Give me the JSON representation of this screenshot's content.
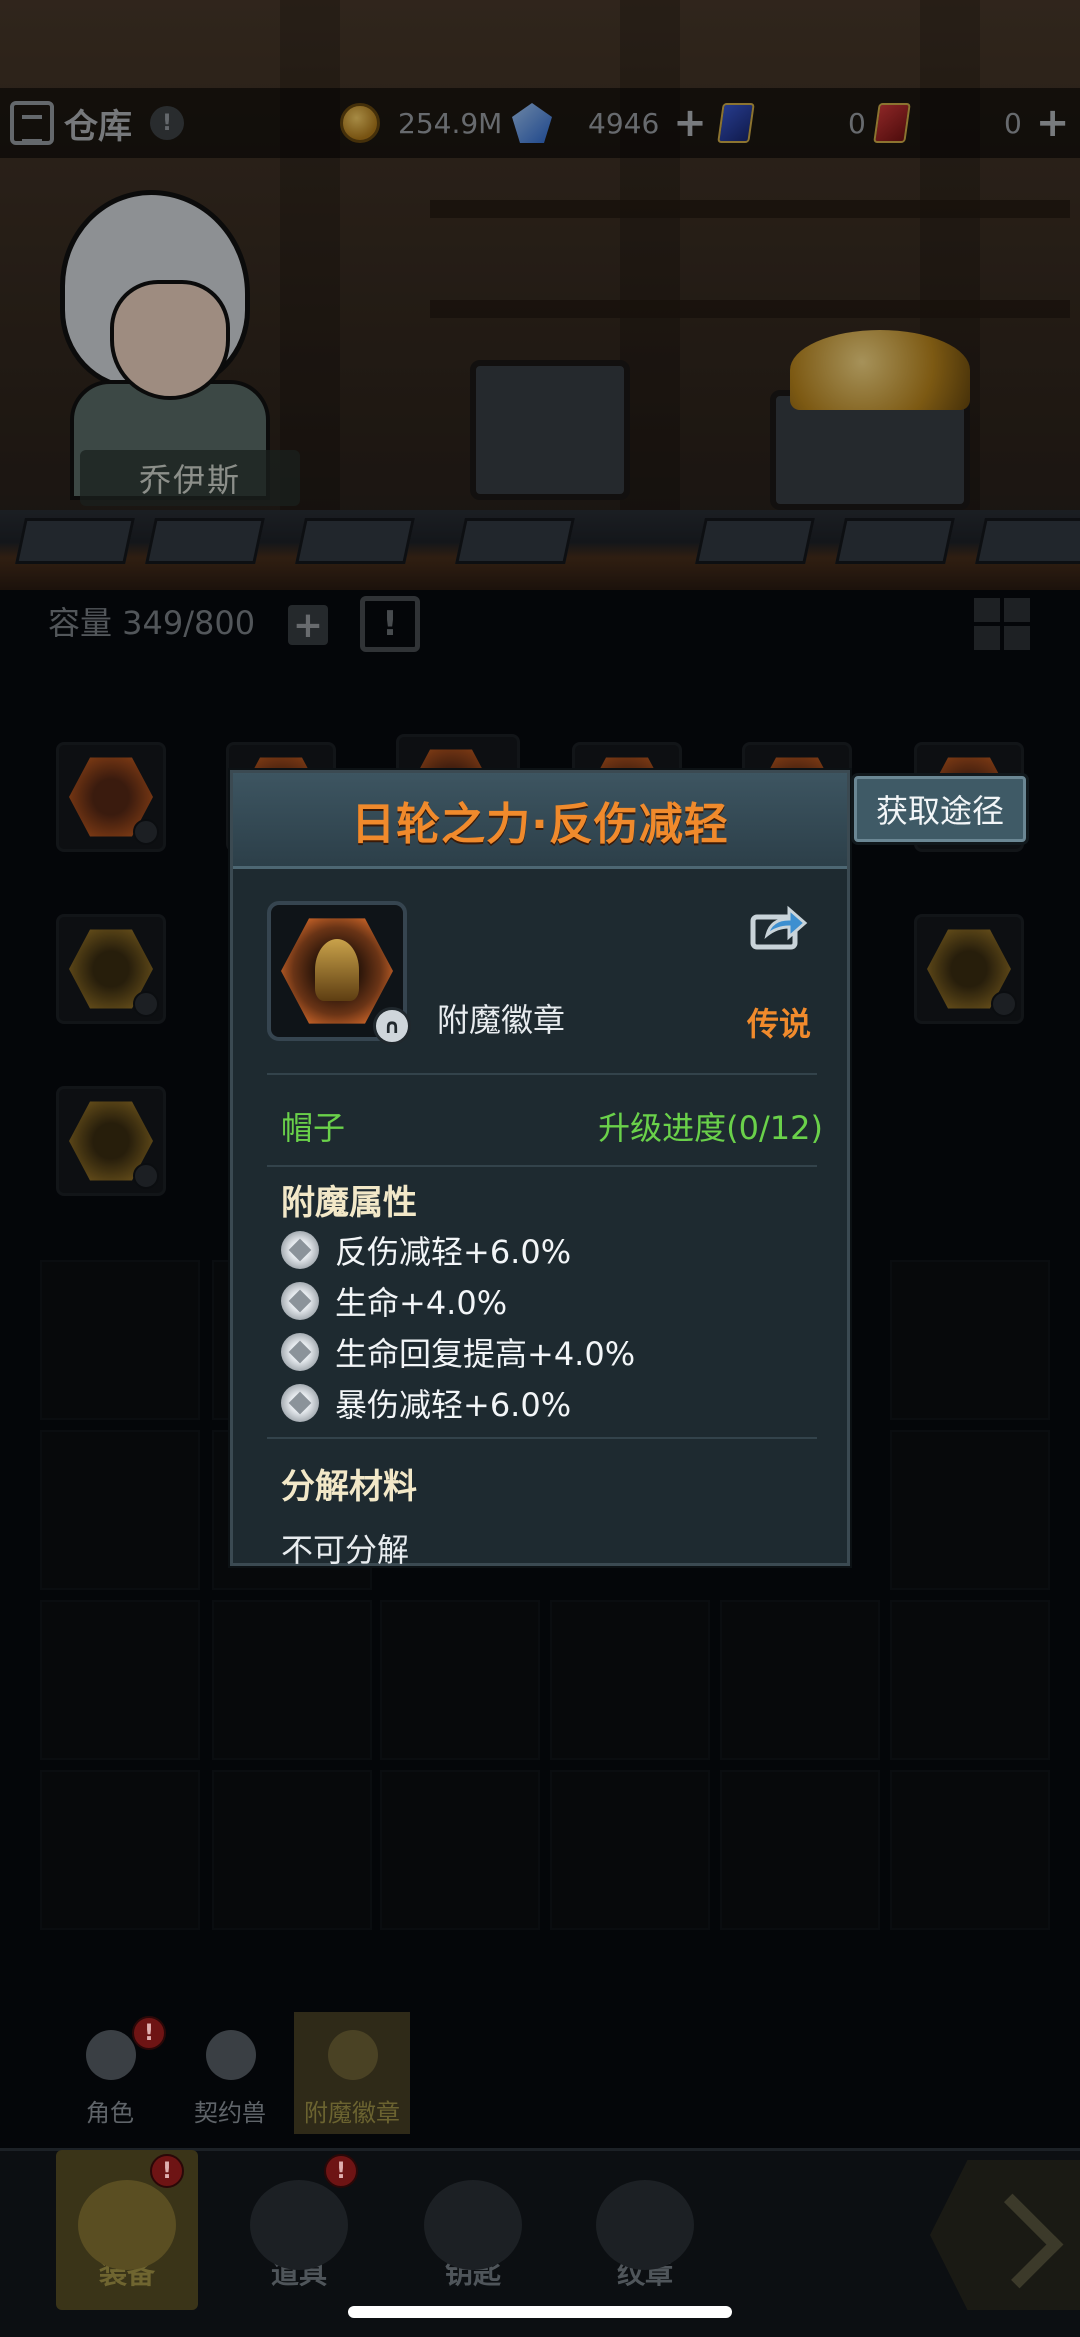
{
  "topbar": {
    "title": "仓库",
    "alert": "!",
    "coins": "254.9M",
    "gems": "4946",
    "blue_cards": "0",
    "red_cards": "0",
    "plus_label": "+"
  },
  "scene": {
    "character_name": "乔伊斯"
  },
  "capacity": {
    "label": "容量 349/800",
    "plus_label": "+",
    "calendar_label": "!"
  },
  "popup": {
    "title": "日轮之力·反伤减轻",
    "source_button": "获取途径",
    "item_type": "附魔徽章",
    "rarity": "传说",
    "slot": "帽子",
    "upgrade_progress": "升级进度(0/12)",
    "attributes_title": "附魔属性",
    "attributes": [
      "反伤减轻+6.0%",
      "生命+4.0%",
      "生命回复提高+4.0%",
      "暴伤减轻+6.0%"
    ],
    "decompose_title": "分解材料",
    "decompose_value": "不可分解",
    "colors": {
      "title": "#f08a2c",
      "green": "#6ad14a",
      "panel": "#1e2a30"
    }
  },
  "subtabs": [
    {
      "label": "角色",
      "badge": "!"
    },
    {
      "label": "契约兽"
    },
    {
      "label": "附魔徽章"
    }
  ],
  "bottom_tabs": [
    {
      "label": "装备",
      "badge": "!"
    },
    {
      "label": "道具",
      "badge": "!"
    },
    {
      "label": "钥匙"
    },
    {
      "label": "纹章"
    }
  ]
}
